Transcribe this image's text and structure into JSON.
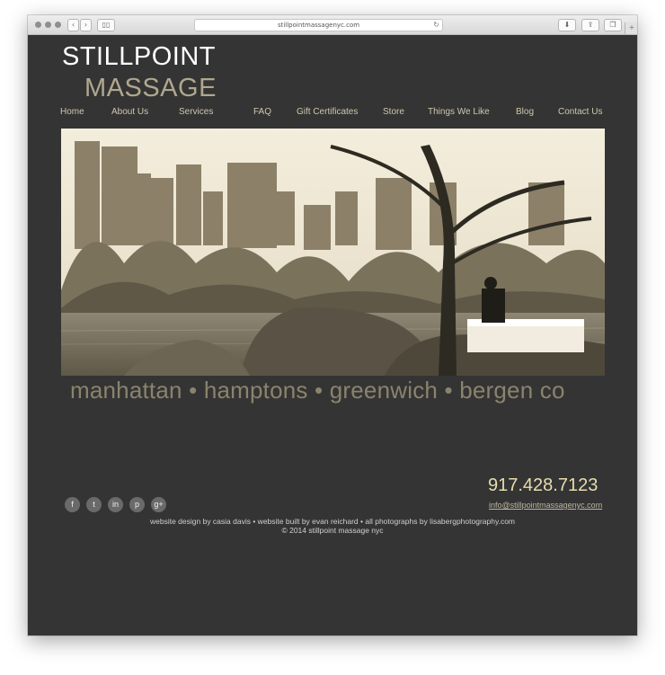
{
  "browser": {
    "url": "stillpointmassagenyc.com"
  },
  "logo": {
    "line1": "STILLPOINT",
    "line2": "MASSAGE"
  },
  "nav": {
    "items": [
      {
        "label": "Home"
      },
      {
        "label": "About Us"
      },
      {
        "label": "Services"
      },
      {
        "label": "FAQ"
      },
      {
        "label": "Gift Certificates"
      },
      {
        "label": "Store"
      },
      {
        "label": "Things We Like"
      },
      {
        "label": "Blog"
      },
      {
        "label": "Contact Us"
      }
    ]
  },
  "hero": {
    "icon": "central-park-massage-photo"
  },
  "locations": "manhattan • hamptons • greenwich • bergen co",
  "contact": {
    "phone": "917.428.7123",
    "email": "info@stillpointmassagenyc.com"
  },
  "social": [
    {
      "icon": "facebook-icon",
      "glyph": "f"
    },
    {
      "icon": "twitter-icon",
      "glyph": "t"
    },
    {
      "icon": "linkedin-icon",
      "glyph": "in"
    },
    {
      "icon": "pinterest-icon",
      "glyph": "p"
    },
    {
      "icon": "googleplus-icon",
      "glyph": "g+"
    }
  ],
  "footer": {
    "credits": "website design by casia davis • website built by evan reichard • all photographs by lisabergphotography.com",
    "copyright": "© 2014 stillpoint massage nyc"
  },
  "colors": {
    "background": "#343434",
    "logo_accent": "#b0a78f",
    "nav_text": "#cfc7ad",
    "phone": "#e8dcae"
  }
}
